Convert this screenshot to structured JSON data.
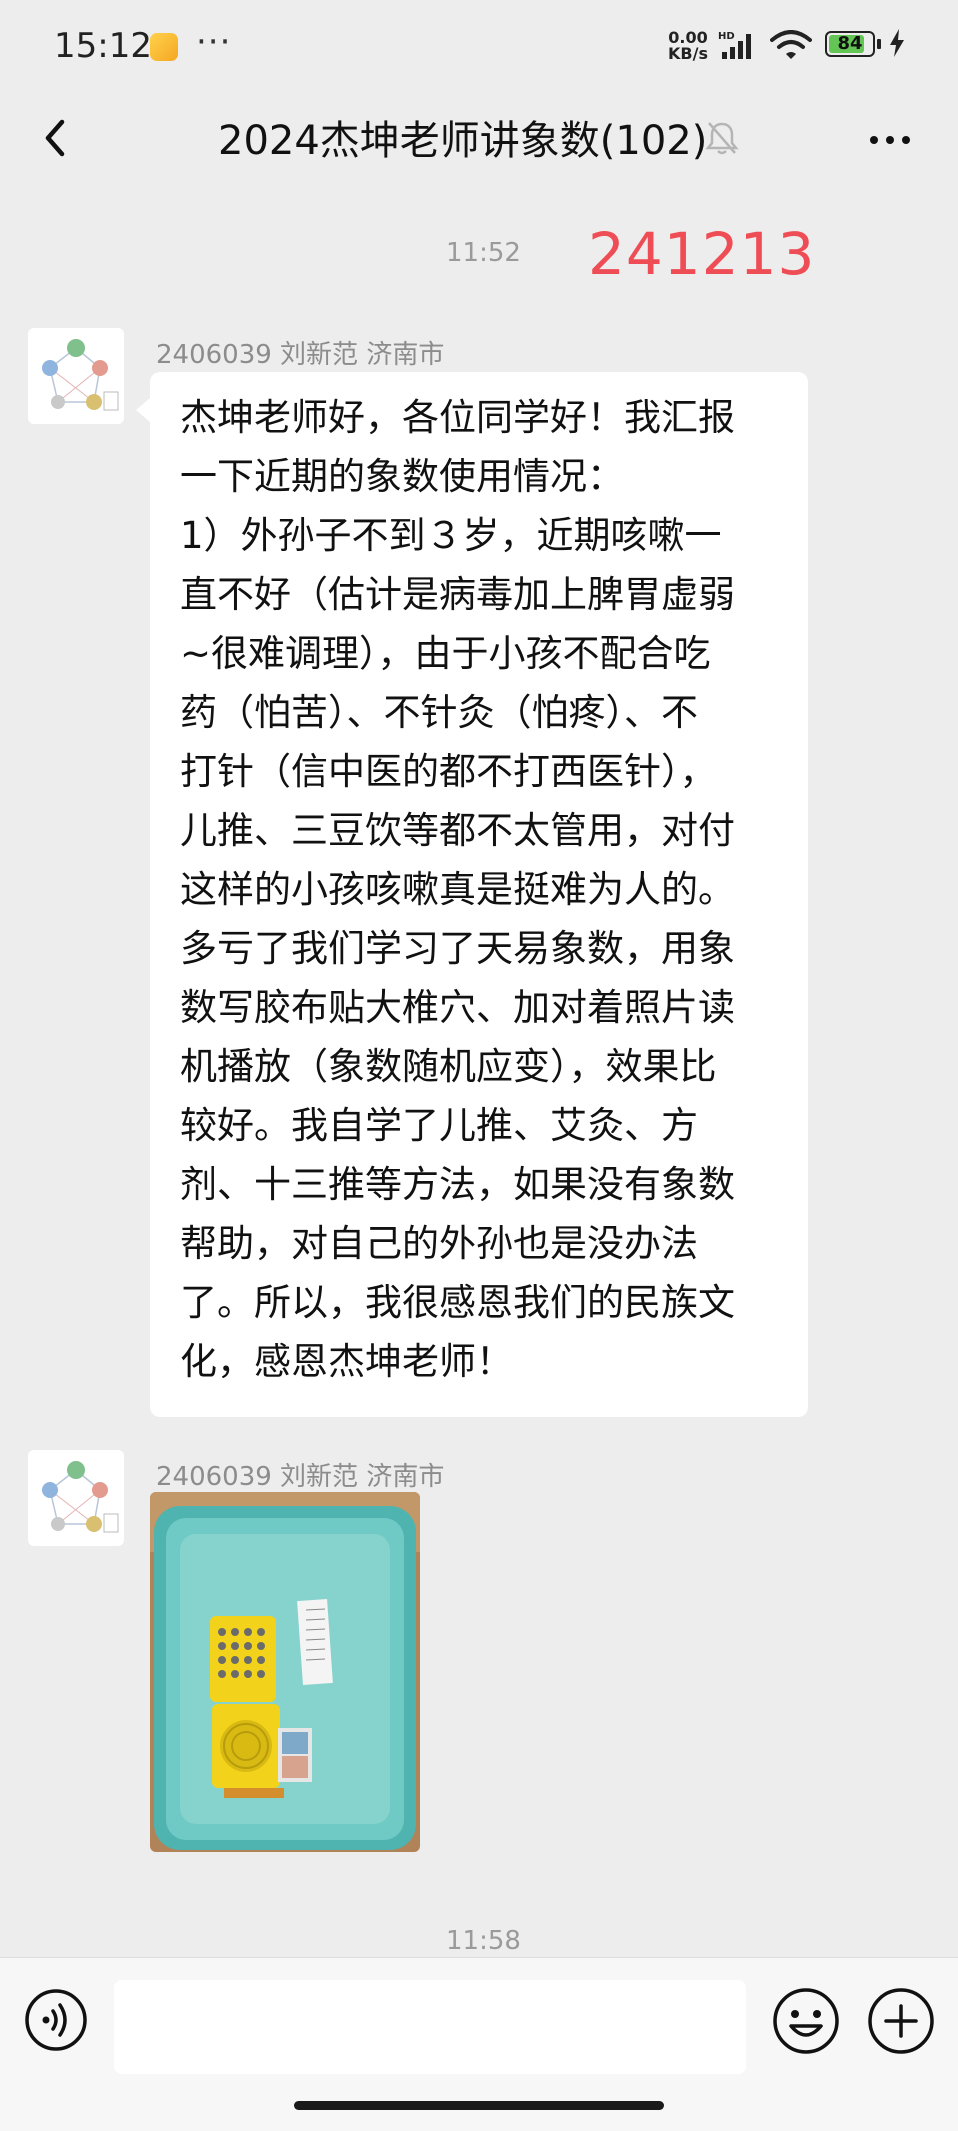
{
  "status_bar": {
    "time": "15:12",
    "net_speed_value": "0.00",
    "net_speed_unit": "KB/s",
    "signal_badge": "HD",
    "battery": "84",
    "battery_level": 0.84,
    "icons": [
      "app-notification-icon",
      "more-dots-icon",
      "signal-icon",
      "wifi-icon",
      "battery-icon",
      "charging-icon"
    ]
  },
  "header": {
    "title": "2024杰坤老师讲象数(102)",
    "icons": [
      "back-arrow-icon",
      "mute-bell-icon",
      "more-dots-icon"
    ]
  },
  "chat": {
    "timestamp_1": "11:52",
    "date_overlay": "241213",
    "date_overlay_color": "#ef4d55",
    "messages": [
      {
        "sender": "2406039 刘新范 济南市",
        "type": "text",
        "lines": [
          "杰坤老师好，各位同学好！我汇报",
          "一下近期的象数使用情况：",
          "1）外孙子不到３岁，近期咳嗽一",
          "直不好（估计是病毒加上脾胃虚弱",
          "~很难调理），由于小孩不配合吃",
          "药（怕苦）、不针灸（怕疼）、不",
          "打针（信中医的都不打西医针），",
          "儿推、三豆饮等都不太管用，对付",
          "这样的小孩咳嗽真是挺难为人的。",
          "多亏了我们学习了天易象数，用象",
          "数写胶布贴大椎穴、加对着照片读",
          "机播放（象数随机应变），效果比",
          "较好。我自学了儿推、艾灸、方",
          "剂、十三推等方法，如果没有象数",
          "帮助，对自己的外孙也是没办法",
          "了。所以，我很感恩我们的民族文",
          "化，感恩杰坤老师！"
        ]
      },
      {
        "sender": "2406039 刘新范 济南市",
        "type": "image"
      }
    ],
    "timestamp_2": "11:58"
  },
  "input_bar": {
    "placeholder": "",
    "icons": [
      "voice-icon",
      "emoji-icon",
      "plus-icon"
    ]
  },
  "colors": {
    "background": "#ededed",
    "bubble": "#ffffff",
    "bar": "#f7f7f7",
    "basin": "#5bbcb8",
    "device": "#f2d21b"
  }
}
